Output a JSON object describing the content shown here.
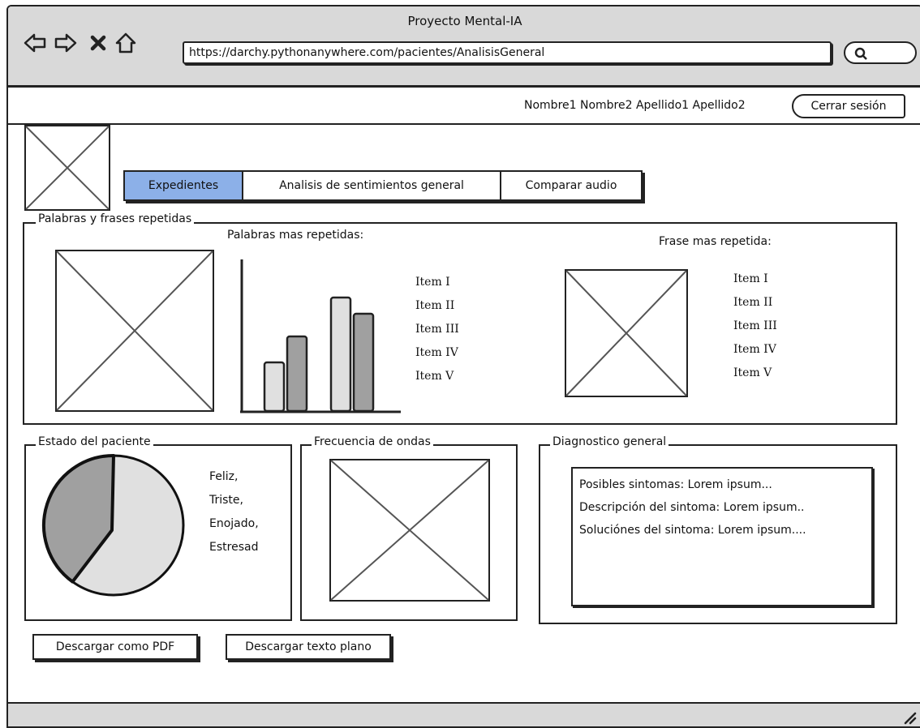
{
  "window": {
    "title": "Proyecto Mental-IA"
  },
  "browser": {
    "url": "https://darchy.pythonanywhere.com/pacientes/AnalisisGeneral",
    "nav_icons": [
      "back-arrow-icon",
      "forward-arrow-icon",
      "close-icon",
      "home-icon"
    ],
    "search_icon": "search-icon"
  },
  "header": {
    "user_name": "Nombre1 Nombre2 Apellido1 Apellido2",
    "logout_label": "Cerrar sesión"
  },
  "tabs": [
    {
      "label": "Expedientes",
      "active": true
    },
    {
      "label": "Analisis de sentimientos general",
      "active": false
    },
    {
      "label": "Comparar audio",
      "active": false
    }
  ],
  "words_section": {
    "legend": "Palabras y frases repetidas",
    "words_title": "Palabras mas repetidas:",
    "phrase_title": "Frase mas repetida:",
    "words_items": [
      "Item I",
      "Item II",
      "Item III",
      "Item IV",
      "Item V"
    ],
    "phrase_items": [
      "Item I",
      "Item II",
      "Item III",
      "Item IV",
      "Item V"
    ]
  },
  "chart_data": {
    "type": "bar",
    "values": [
      30,
      46,
      70,
      60
    ],
    "colors": [
      "#e0e0e0",
      "#a0a0a0",
      "#e0e0e0",
      "#a0a0a0"
    ]
  },
  "patient_state": {
    "legend": "Estado del paciente",
    "items": [
      "Feliz,",
      "Triste,",
      "Enojado,",
      "Estresad"
    ],
    "pie_fraction_dark": 0.4,
    "colors": {
      "light": "#e0e0e0",
      "dark": "#a0a0a0"
    }
  },
  "waves": {
    "legend": "Frecuencia de ondas"
  },
  "diagnosis": {
    "legend": "Diagnostico general",
    "lines": [
      "Posibles sintomas: Lorem ipsum...",
      "Descripción del sintoma: Lorem ipsum..",
      "Soluciónes del sintoma: Lorem ipsum...."
    ]
  },
  "downloads": {
    "pdf_label": "Descargar como PDF",
    "text_label": "Descargar texto plano"
  },
  "colors": {
    "accent": "#8cb0e8",
    "chrome": "#d9d9d9"
  }
}
